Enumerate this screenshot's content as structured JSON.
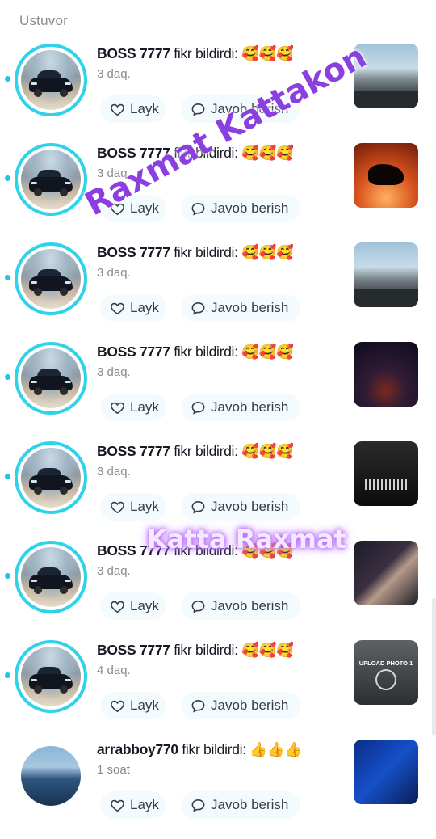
{
  "section_title": "Ustuvor",
  "like_label": "Layk",
  "reply_label": "Javob berish",
  "watermark_top": "Raxmat Kattakon",
  "watermark_mid": "Katta Raxmat",
  "accent_color": "#2ed3ea",
  "notifications": [
    {
      "user": "BOSS 7777",
      "action": "fikr bildirdi:",
      "emoji": "🥰🥰🥰",
      "time": "3 daq.",
      "thumb": "road",
      "unread": true
    },
    {
      "user": "BOSS 7777",
      "action": "fikr bildirdi:",
      "emoji": "🥰🥰🥰",
      "time": "3 daq.",
      "thumb": "horse",
      "unread": true
    },
    {
      "user": "BOSS 7777",
      "action": "fikr bildirdi:",
      "emoji": "🥰🥰🥰",
      "time": "3 daq.",
      "thumb": "road",
      "unread": true
    },
    {
      "user": "BOSS 7777",
      "action": "fikr bildirdi:",
      "emoji": "🥰🥰🥰",
      "time": "3 daq.",
      "thumb": "night",
      "unread": true
    },
    {
      "user": "BOSS 7777",
      "action": "fikr bildirdi:",
      "emoji": "🥰🥰🥰",
      "time": "3 daq.",
      "thumb": "voice",
      "unread": true
    },
    {
      "user": "BOSS 7777",
      "action": "fikr bildirdi:",
      "emoji": "🥰🥰🥰",
      "time": "3 daq.",
      "thumb": "couple",
      "unread": true
    },
    {
      "user": "BOSS 7777",
      "action": "fikr bildirdi:",
      "emoji": "🥰🥰🥰",
      "time": "4 daq.",
      "thumb": "upload",
      "thumb_text": "UPLOAD PHOTO 1",
      "unread": true
    },
    {
      "user": "arrabboy770",
      "action": "fikr bildirdi:",
      "emoji": "👍👍👍",
      "time": "1 soat",
      "thumb": "blue",
      "unread": false
    }
  ]
}
